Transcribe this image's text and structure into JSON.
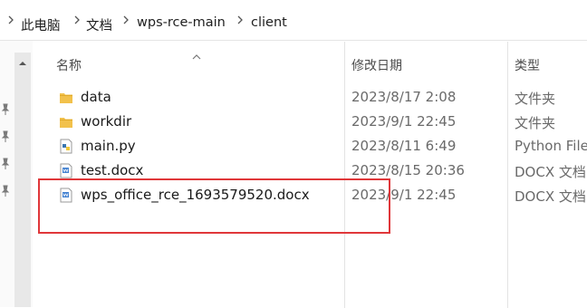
{
  "breadcrumb": {
    "items": [
      "此电脑",
      "文档",
      "wps-rce-main",
      "client"
    ]
  },
  "columns": {
    "name": "名称",
    "date_modified": "修改日期",
    "type": "类型"
  },
  "files": [
    {
      "name": "data",
      "date": "2023/8/17 2:08",
      "type": "文件夹",
      "icon": "folder-icon"
    },
    {
      "name": "workdir",
      "date": "2023/9/1 22:45",
      "type": "文件夹",
      "icon": "folder-icon"
    },
    {
      "name": "main.py",
      "date": "2023/8/11 6:49",
      "type": "Python File",
      "icon": "python-file-icon"
    },
    {
      "name": "test.docx",
      "date": "2023/8/15 20:36",
      "type": "DOCX 文档",
      "icon": "docx-file-icon"
    },
    {
      "name": "wps_office_rce_1693579520.docx",
      "date": "2023/9/1 22:45",
      "type": "DOCX 文档",
      "icon": "docx-file-icon"
    }
  ],
  "colors": {
    "highlight_border": "#e0373a",
    "folder": "#f2c14b"
  }
}
